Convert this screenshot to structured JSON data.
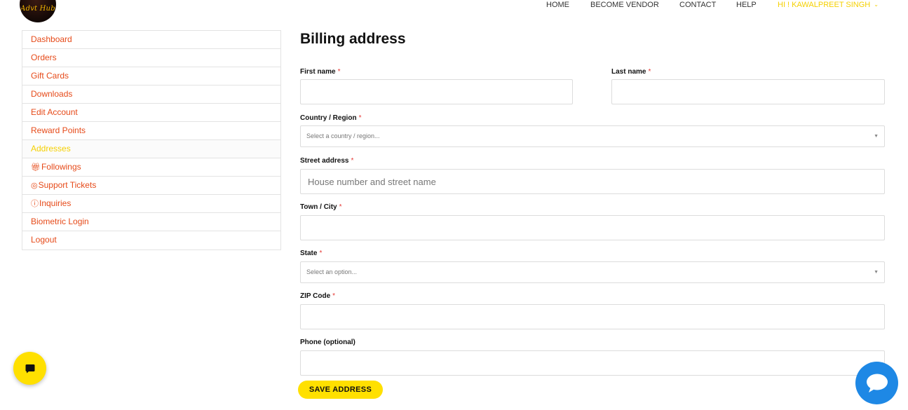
{
  "header": {
    "logo_text": "Advt Hub",
    "nav": [
      "HOME",
      "BECOME VENDOR",
      "CONTACT",
      "HELP"
    ],
    "user_menu": "HI ! KAWALPREET SINGH",
    "user_menu_icon": "chevron-down-icon"
  },
  "sidebar": {
    "items": [
      {
        "label": "Dashboard"
      },
      {
        "label": "Orders"
      },
      {
        "label": "Gift Cards"
      },
      {
        "label": "Downloads"
      },
      {
        "label": "Edit Account"
      },
      {
        "label": "Reward Points"
      },
      {
        "label": "Addresses",
        "active": true
      },
      {
        "label": "Followings",
        "icon": "gift-icon"
      },
      {
        "label": "Support Tickets",
        "icon": "lifebuoy-icon"
      },
      {
        "label": "Inquiries",
        "icon": "question-circle-icon"
      },
      {
        "label": "Biometric Login"
      },
      {
        "label": "Logout"
      }
    ]
  },
  "form": {
    "title": "Billing address",
    "required_mark": "*",
    "fields": {
      "first_name": {
        "label": "First name",
        "value": ""
      },
      "last_name": {
        "label": "Last name",
        "value": ""
      },
      "country": {
        "label": "Country / Region",
        "placeholder": "Select a country / region..."
      },
      "street": {
        "label": "Street address",
        "placeholder": "House number and street name"
      },
      "town": {
        "label": "Town / City",
        "value": ""
      },
      "state": {
        "label": "State",
        "placeholder": "Select an option..."
      },
      "zip": {
        "label": "ZIP Code",
        "value": ""
      },
      "phone": {
        "label": "Phone (optional)",
        "value": ""
      }
    },
    "save_label": "SAVE ADDRESS"
  },
  "colors": {
    "accent_yellow": "#ffe000",
    "sidebar_link": "#e64a19",
    "active_link": "#f5d000",
    "required": "#e53935",
    "chat_blue": "#1e88e5"
  }
}
